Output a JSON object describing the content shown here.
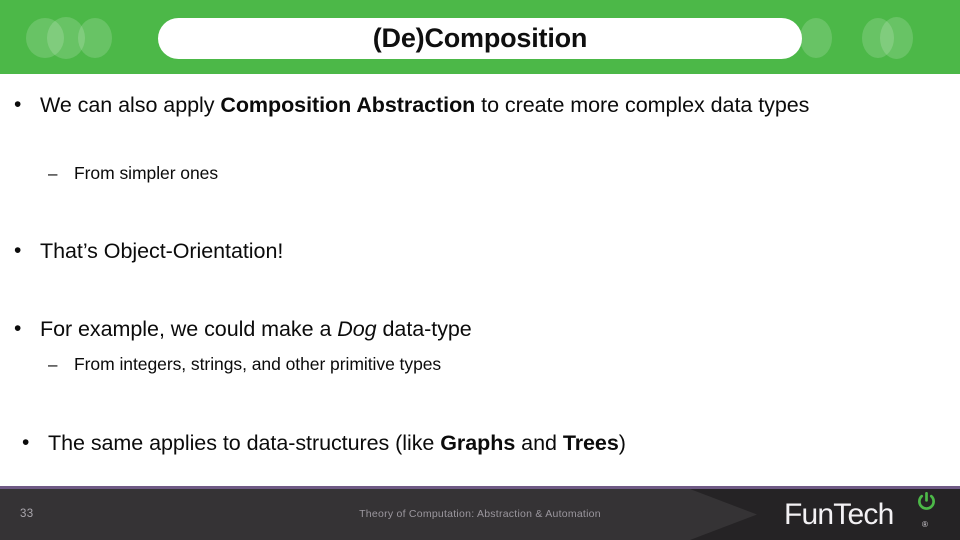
{
  "slide": {
    "title": "(De)Composition",
    "header_color": "#4CB848",
    "accent_rule_color": "#6F5A85",
    "footer_color": "#252325",
    "footer_panel_color": "#353335"
  },
  "bullets": [
    {
      "level": 1,
      "marker": "•",
      "text_plain": "We can also apply Composition Abstraction to create more complex data types",
      "runs": [
        {
          "t": "We can also apply ",
          "style": "normal"
        },
        {
          "t": "Composition Abstraction",
          "style": "bold"
        },
        {
          "t": " to create more complex data types",
          "style": "normal"
        }
      ]
    },
    {
      "level": 2,
      "marker": "–",
      "text_plain": "From simpler ones",
      "runs": [
        {
          "t": "From simpler ones",
          "style": "normal"
        }
      ]
    },
    {
      "level": 1,
      "marker": "•",
      "text_plain": "That’s Object-Orientation!",
      "runs": [
        {
          "t": "That’s Object-Orientation!",
          "style": "normal"
        }
      ]
    },
    {
      "level": 1,
      "marker": "•",
      "text_plain": "For example, we could make a Dog data-type",
      "runs": [
        {
          "t": "For example, we could make a ",
          "style": "normal"
        },
        {
          "t": "Dog",
          "style": "italic"
        },
        {
          "t": " data-type",
          "style": "normal"
        }
      ]
    },
    {
      "level": 2,
      "marker": "–",
      "text_plain": "From integers, strings, and other primitive types",
      "runs": [
        {
          "t": "From integers, strings, and other primitive types",
          "style": "normal"
        }
      ]
    },
    {
      "level": 1,
      "marker": "•",
      "text_plain": "The same applies to data-structures (like Graphs and Trees)",
      "runs": [
        {
          "t": "The same applies to data-structures (like ",
          "style": "normal"
        },
        {
          "t": "Graphs",
          "style": "bold"
        },
        {
          "t": " and ",
          "style": "normal"
        },
        {
          "t": "Trees",
          "style": "bold"
        },
        {
          "t": ")",
          "style": "normal"
        }
      ]
    }
  ],
  "footer": {
    "page_number": "33",
    "caption": "Theory of Computation: Abstraction & Automation",
    "logo_text": "FunTech",
    "logo_registered_mark": "®",
    "logo_power_icon": "power-icon",
    "logo_power_color": "#4CB848"
  }
}
